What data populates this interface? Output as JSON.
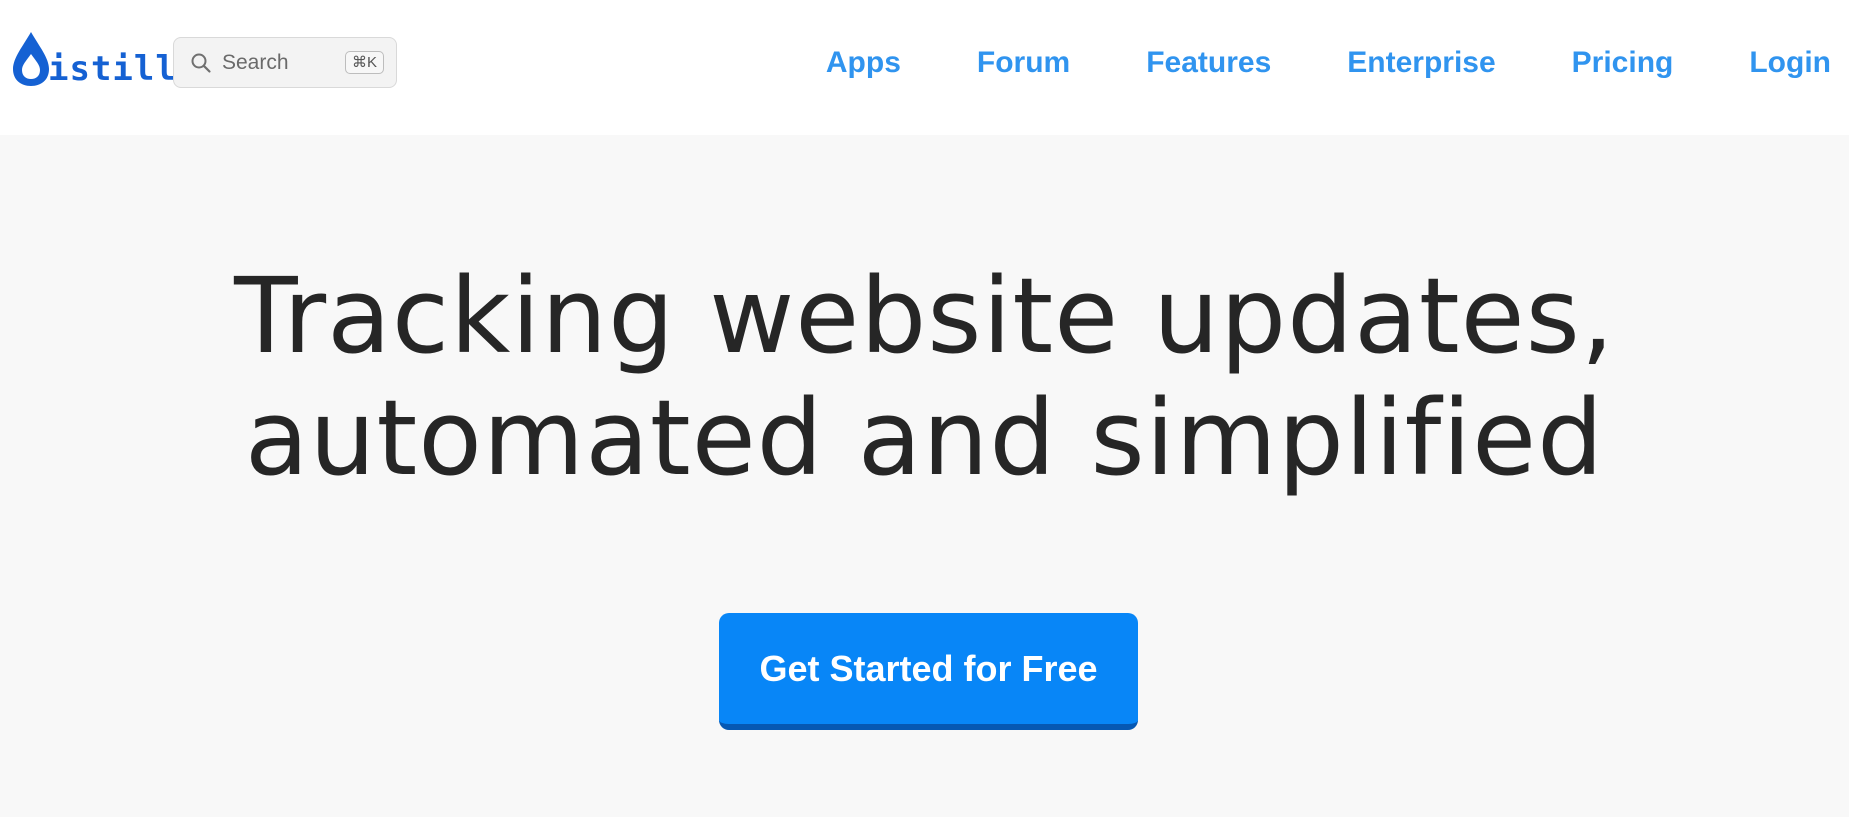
{
  "header": {
    "logo": {
      "text": "istill",
      "alt_text": "Distill",
      "color": "#1561d3"
    },
    "search": {
      "label": "Search",
      "shortcut": "⌘K",
      "icon": "search-icon"
    },
    "nav": {
      "items": [
        {
          "label": "Apps"
        },
        {
          "label": "Forum"
        },
        {
          "label": "Features"
        },
        {
          "label": "Enterprise"
        },
        {
          "label": "Pricing"
        },
        {
          "label": "Login"
        }
      ],
      "color": "#3094ef"
    }
  },
  "hero": {
    "headline_line1": "Tracking website updates,",
    "headline_line2": "automated and simplified",
    "cta_label": "Get Started for Free",
    "cta_color": "#0886f7"
  }
}
